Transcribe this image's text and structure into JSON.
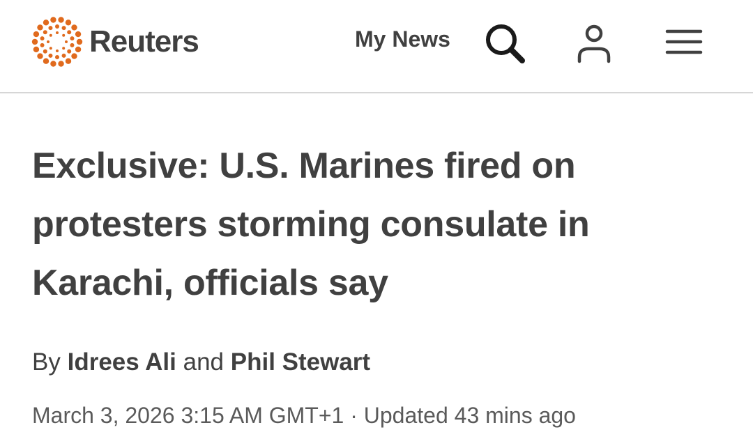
{
  "header": {
    "logo_text": "Reuters",
    "brand_color": "#e06a1d",
    "my_news_label": "My News",
    "icons": [
      "reuters-logo-mark",
      "search-icon",
      "user-icon",
      "hamburger-menu-icon"
    ]
  },
  "article": {
    "headline": "Exclusive: U.S. Marines fired on protesters storming consulate in Karachi, officials say",
    "byline_prefix": "By",
    "author_1": "Idrees Ali",
    "byline_joiner": "and",
    "author_2": "Phil Stewart",
    "published": "March 3, 2026 3:15 AM GMT+1",
    "separator": "·",
    "updated": "Updated 43 mins ago"
  }
}
